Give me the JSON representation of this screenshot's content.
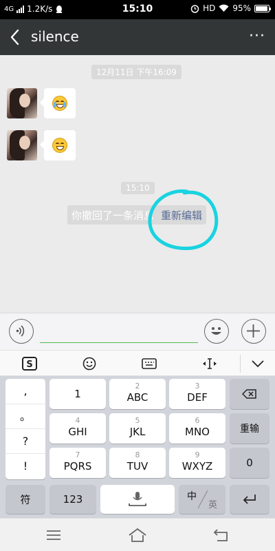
{
  "status_bar": {
    "network": "4G",
    "speed": "1.2K/s",
    "time": "15:10",
    "hd": "HD",
    "battery": "95%",
    "battery_level": 0.95
  },
  "header": {
    "title": "silence",
    "more": "···"
  },
  "chat": {
    "timestamp_1": "12月11日 下午16:09",
    "timestamp_2": "15:10",
    "messages": [
      {
        "type": "emoji",
        "emoji": "crying-face"
      },
      {
        "type": "emoji",
        "emoji": "grinning-face"
      }
    ],
    "recall_text": "你撤回了一条消息",
    "recall_edit": "重新编辑"
  },
  "ime_toolbar": {
    "tools": [
      "sogou-logo-icon",
      "emoji-icon",
      "keyboard-icon",
      "cursor-icon",
      "collapse-icon"
    ],
    "sogou": "S"
  },
  "keyboard": {
    "punct": [
      ",",
      "。",
      "?",
      "!"
    ],
    "rows": [
      [
        {
          "num": "",
          "label": "1"
        },
        {
          "num": "2",
          "label": "ABC"
        },
        {
          "num": "3",
          "label": "DEF"
        }
      ],
      [
        {
          "num": "4",
          "label": "GHI"
        },
        {
          "num": "5",
          "label": "JKL"
        },
        {
          "num": "6",
          "label": "MNO"
        }
      ],
      [
        {
          "num": "7",
          "label": "PQRS"
        },
        {
          "num": "8",
          "label": "TUV"
        },
        {
          "num": "9",
          "label": "WXYZ"
        }
      ]
    ],
    "reenter": "重输",
    "zero": "0",
    "symbol": "符",
    "num_switch": "123",
    "lang_zh": "中",
    "lang_en": "英"
  },
  "colors": {
    "accent": "#4db84d",
    "link": "#576b95",
    "circle": "#19d3e0"
  }
}
